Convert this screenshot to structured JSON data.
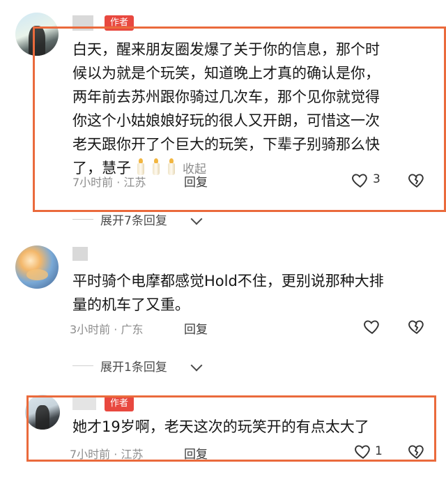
{
  "colors": {
    "author_badge": "#e8483f",
    "highlight": "#ea6a3c",
    "meta_gray": "#8d8d8d"
  },
  "comments": [
    {
      "badge": "作者",
      "lines": [
        "白天，醒来朋友圈发爆了关于你的信息，那个时",
        "候以为就是个玩笑，知道晚上才真的确认是你，",
        "两年前去苏州跟你骑过几次车，那个见你就觉得",
        "你这个小姑娘娘好玩的很人又开朗，可惜这一次",
        "老天跟你开了个巨大的玩笑，下辈子别骑那么快",
        "了，慧子"
      ],
      "emoji_icon": "candle-icon",
      "collapse_label": "收起",
      "time_location": "7小时前 · 江苏",
      "reply_label": "回复",
      "like_count": "3",
      "expand_label": "展开7条回复"
    },
    {
      "lines": [
        "平时骑个电摩都感觉Hold不住，更别说那种大排",
        "量的机车了又重。"
      ],
      "time_location": "3小时前 · 广东",
      "reply_label": "回复",
      "expand_label": "展开1条回复"
    },
    {
      "badge": "作者",
      "lines": [
        "她才19岁啊，老天这次的玩笑开的有点太大了"
      ],
      "time_location": "7小时前 · 江苏",
      "reply_label": "回复",
      "like_count": "1"
    }
  ]
}
